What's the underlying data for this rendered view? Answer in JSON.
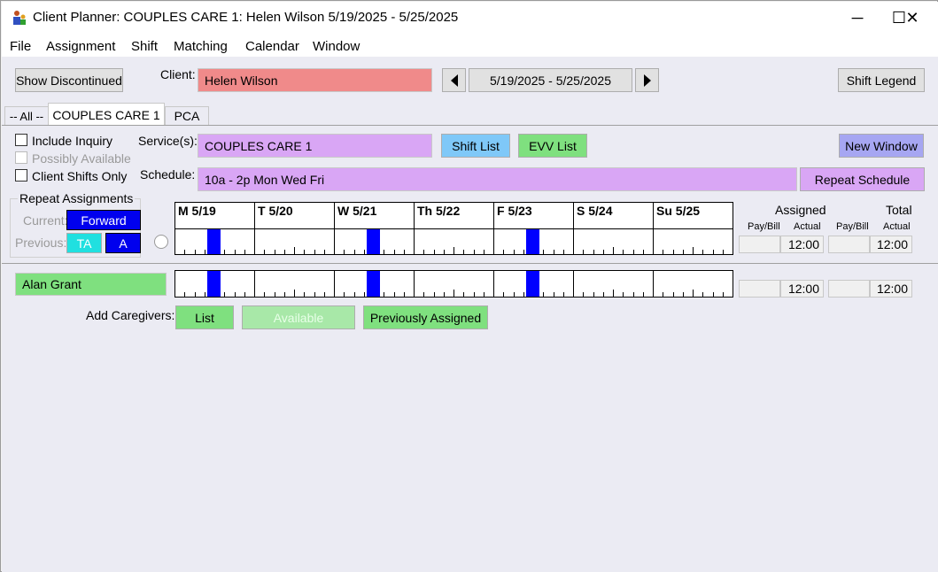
{
  "window": {
    "title": "Client Planner: COUPLES CARE 1: Helen Wilson  5/19/2025 - 5/25/2025",
    "controls": {
      "minimize": "─",
      "maximize": "☐",
      "close": "✕"
    }
  },
  "menu": [
    "File",
    "Assignment",
    "Shift",
    "Matching",
    "Calendar",
    "Window"
  ],
  "toolbar": {
    "show_discontinued": "Show Discontinued",
    "client_label": "Client:",
    "client_name": "Helen Wilson",
    "date_range": "5/19/2025 - 5/25/2025",
    "shift_legend": "Shift Legend"
  },
  "tabs": [
    "-- All --",
    "COUPLES CARE 1",
    "PCA"
  ],
  "options": {
    "include_inquiry": "Include Inquiry",
    "possibly_available": "Possibly Available",
    "client_shifts_only": "Client Shifts Only"
  },
  "service": {
    "label": "Service(s):",
    "value": "COUPLES CARE 1",
    "shift_list": "Shift List",
    "evv_list": "EVV List",
    "new_window": "New Window"
  },
  "schedule": {
    "label": "Schedule:",
    "value": "10a - 2p Mon Wed Fri",
    "repeat_schedule": "Repeat Schedule"
  },
  "repeat": {
    "title": "Repeat Assignments",
    "current_label": "Current:",
    "current_btn": "Forward",
    "previous_label": "Previous:",
    "prev_ta": "TA",
    "prev_a": "A"
  },
  "days": [
    "M 5/19",
    "T 5/20",
    "W 5/21",
    "Th 5/22",
    "F 5/23",
    "S 5/24",
    "Su 5/25"
  ],
  "totals": {
    "assigned": "Assigned",
    "total": "Total",
    "pay_bill": "Pay/Bill",
    "actual": "Actual",
    "pay_bill2": "Pay/Bill",
    "actual2": "Actual",
    "client_assigned_actual": "12:00",
    "client_total_actual": "12:00"
  },
  "caregiver": {
    "name": "Alan Grant",
    "assigned_actual": "12:00",
    "total_actual": "12:00"
  },
  "add_caregivers": {
    "label": "Add Caregivers:",
    "list": "List",
    "available": "Available",
    "previously_assigned": "Previously Assigned"
  },
  "colors": {
    "client_field": "#f08a8a",
    "service_field": "#d9a6f5",
    "shift_list": "#7fc8f8",
    "green": "#7fe07f",
    "blue_btn": "#0000ee",
    "cyan_btn": "#20e0e0",
    "shift_bar": "#0000ff"
  }
}
